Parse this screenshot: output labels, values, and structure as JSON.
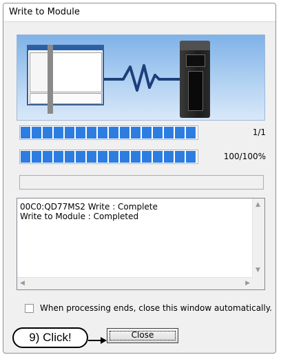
{
  "window": {
    "title": "Write to Module"
  },
  "progress": [
    {
      "label": "1/1",
      "fraction": 1.0,
      "segments": 16
    },
    {
      "label": "100/100%",
      "fraction": 1.0,
      "segments": 16
    }
  ],
  "log": {
    "lines": [
      "00C0:QD77MS2 Write : Complete",
      "Write to Module : Completed"
    ]
  },
  "auto_close": {
    "label": "When processing ends, close this window automatically.",
    "checked": false
  },
  "buttons": {
    "close": "Close"
  },
  "annotation": {
    "callout": "9) Click!"
  },
  "colors": {
    "progress": "#2d7de0",
    "banner_sky": "#b6d4f3"
  }
}
